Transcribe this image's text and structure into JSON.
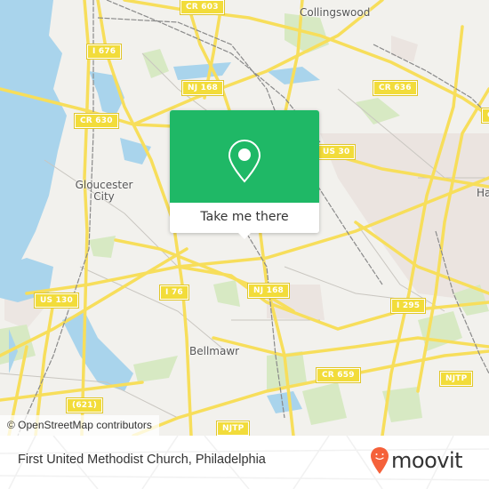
{
  "map": {
    "colors": {
      "land": "#f2f1ed",
      "water": "#a9d4ec",
      "park": "#d6eac1",
      "urban": "#e8e0dc",
      "road": "#f7de5b",
      "rail": "#8a8a8a",
      "shield_bg": "#f2dc3a"
    },
    "road_shields": [
      {
        "id": "cr603",
        "label": "CR 603"
      },
      {
        "id": "i676",
        "label": "I 676"
      },
      {
        "id": "nj168a",
        "label": "NJ 168"
      },
      {
        "id": "cr636",
        "label": "CR 636"
      },
      {
        "id": "cr630",
        "label": "CR 630"
      },
      {
        "id": "us30",
        "label": "US 30"
      },
      {
        "id": "us130",
        "label": "US 130"
      },
      {
        "id": "i76",
        "label": "I 76"
      },
      {
        "id": "nj168b",
        "label": "NJ 168"
      },
      {
        "id": "i295",
        "label": "I 295"
      },
      {
        "id": "cr659",
        "label": "CR 659"
      },
      {
        "id": "njtp1",
        "label": "NJTP"
      },
      {
        "id": "c621",
        "label": "(621)"
      },
      {
        "id": "njtp2",
        "label": "NJTP"
      },
      {
        "id": "cEdge",
        "label": "C"
      }
    ],
    "places": [
      {
        "id": "collingswood",
        "label": "Collingswood"
      },
      {
        "id": "gloucester",
        "label": "Gloucester City"
      },
      {
        "id": "bellmawr",
        "label": "Bellmawr"
      },
      {
        "id": "haddon",
        "label": "Ha"
      }
    ],
    "attribution": "© OpenStreetMap contributors"
  },
  "popup": {
    "icon": "location-pin-icon",
    "accent": "#1fb866",
    "button_label": "Take me there"
  },
  "footer": {
    "title": "First United Methodist Church, Philadelphia",
    "brand": "moovit",
    "brand_color": "#f5613a"
  }
}
